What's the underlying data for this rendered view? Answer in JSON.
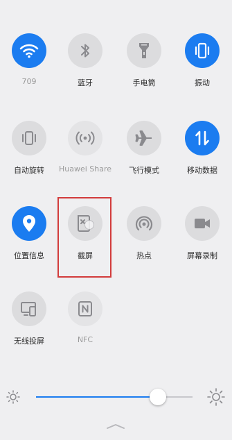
{
  "colors": {
    "accent": "#1b7cf0",
    "inactive_circle": "#dcdcde",
    "highlight": "#d23b3b"
  },
  "tiles": [
    {
      "label": "709",
      "icon": "wifi-icon",
      "state": "active"
    },
    {
      "label": "蓝牙",
      "icon": "bluetooth-icon",
      "state": "off"
    },
    {
      "label": "手电筒",
      "icon": "flashlight-icon",
      "state": "off"
    },
    {
      "label": "振动",
      "icon": "vibrate-icon",
      "state": "active"
    },
    {
      "label": "自动旋转",
      "icon": "auto-rotate-icon",
      "state": "off"
    },
    {
      "label": "Huawei Share",
      "icon": "huawei-share-icon",
      "state": "disabled"
    },
    {
      "label": "飞行模式",
      "icon": "airplane-icon",
      "state": "off"
    },
    {
      "label": "移动数据",
      "icon": "mobile-data-icon",
      "state": "active"
    },
    {
      "label": "位置信息",
      "icon": "location-icon",
      "state": "active"
    },
    {
      "label": "截屏",
      "icon": "screenshot-icon",
      "state": "off"
    },
    {
      "label": "热点",
      "icon": "hotspot-icon",
      "state": "off"
    },
    {
      "label": "屏幕录制",
      "icon": "screen-record-icon",
      "state": "off"
    },
    {
      "label": "无线投屏",
      "icon": "wireless-projection-icon",
      "state": "off"
    },
    {
      "label": "NFC",
      "icon": "nfc-icon",
      "state": "disabled"
    }
  ],
  "brightness": {
    "level": 0.78,
    "low_icon": "brightness-low-icon",
    "high_icon": "brightness-high-icon"
  },
  "handle_icon": "chevron-up-icon"
}
